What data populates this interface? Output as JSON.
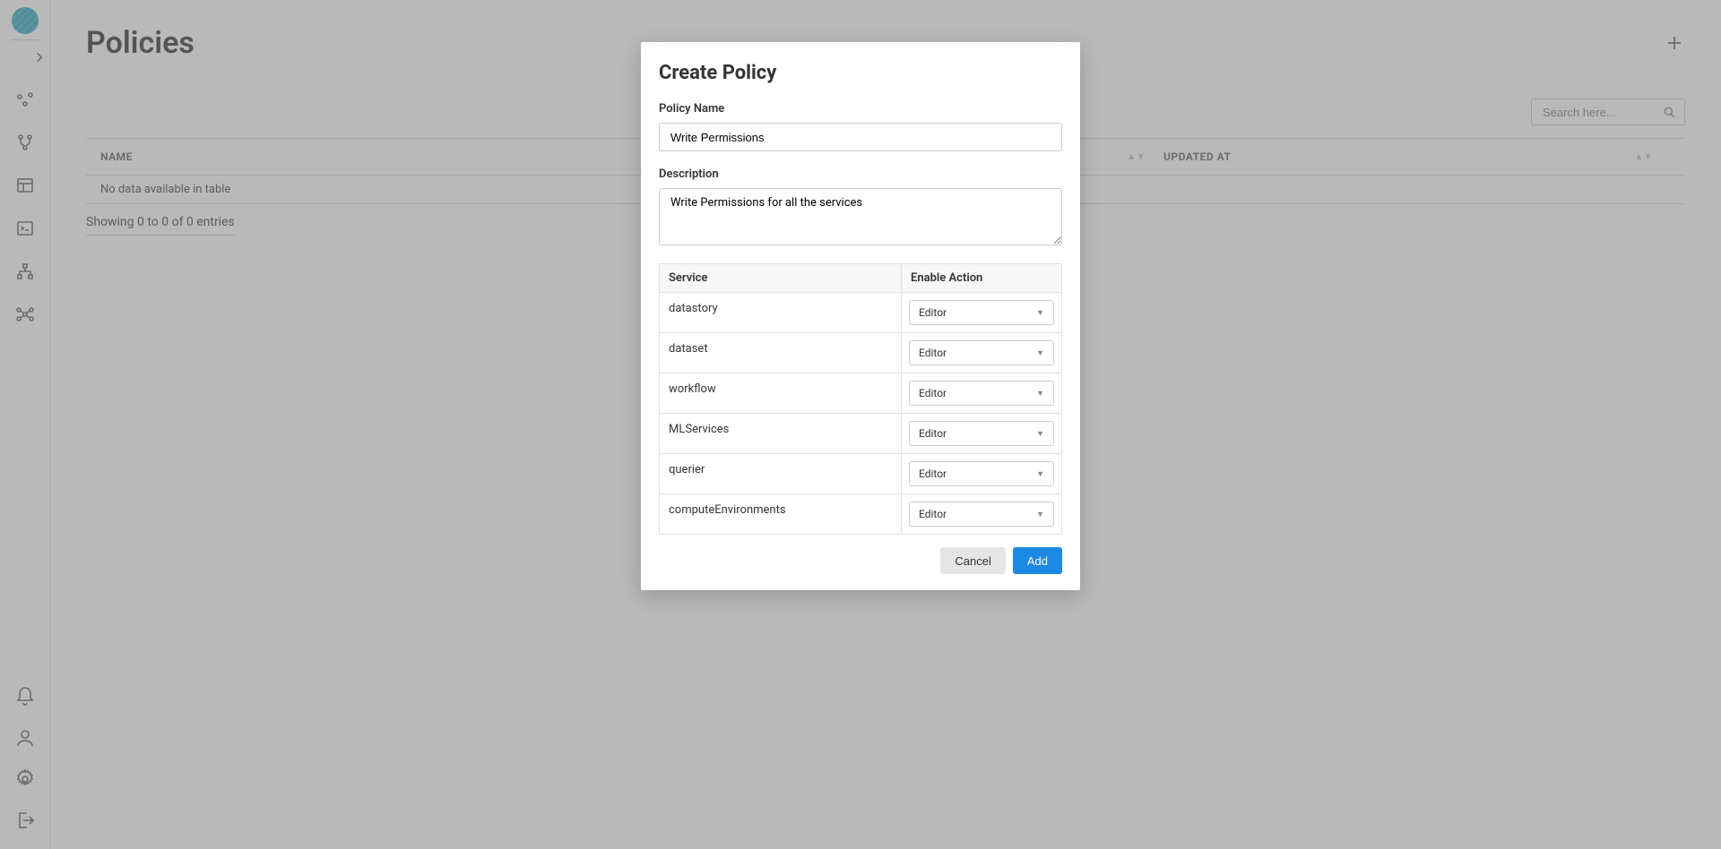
{
  "page": {
    "title": "Policies",
    "search_placeholder": "Search here...",
    "table": {
      "col_name": "NAME",
      "col_updated": "UPDATED AT",
      "empty": "No data available in table",
      "info": "Showing 0 to 0 of 0 entries"
    }
  },
  "modal": {
    "title": "Create Policy",
    "name_label": "Policy Name",
    "name_value": "Write Permissions",
    "desc_label": "Description",
    "desc_value": "Write Permissions for all the services",
    "svc_header_service": "Service",
    "svc_header_action": "Enable Action",
    "services": [
      {
        "name": "datastory",
        "action": "Editor"
      },
      {
        "name": "dataset",
        "action": "Editor"
      },
      {
        "name": "workflow",
        "action": "Editor"
      },
      {
        "name": "MLServices",
        "action": "Editor"
      },
      {
        "name": "querier",
        "action": "Editor"
      },
      {
        "name": "computeEnvironments",
        "action": "Editor"
      }
    ],
    "cancel": "Cancel",
    "add": "Add"
  }
}
